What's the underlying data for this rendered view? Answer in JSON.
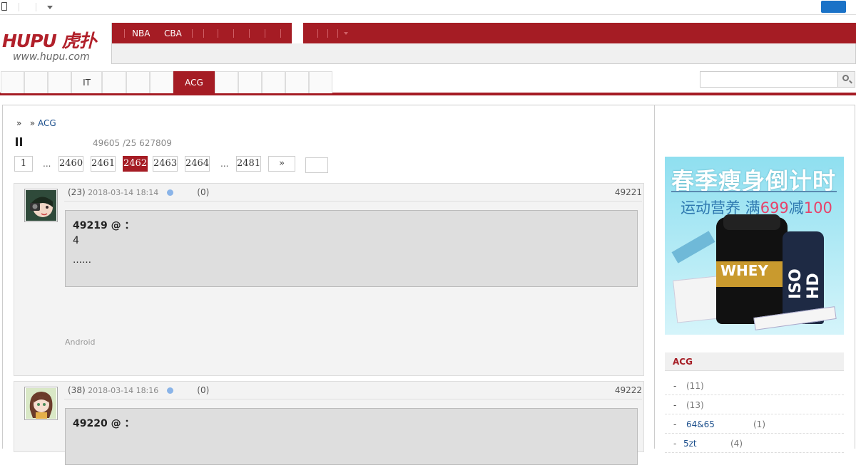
{
  "header": {
    "logo_text": "HUPU 虎扑",
    "logo_url": "www.hupu.com",
    "nav": [
      "NBA",
      "CBA"
    ]
  },
  "subnav": {
    "tabs": [
      {
        "label": ""
      },
      {
        "label": ""
      },
      {
        "label": ""
      },
      {
        "label": "IT"
      },
      {
        "label": ""
      },
      {
        "label": ""
      },
      {
        "label": ""
      },
      {
        "label": "ACG",
        "active": true
      },
      {
        "label": ""
      },
      {
        "label": ""
      },
      {
        "label": ""
      },
      {
        "label": ""
      },
      {
        "label": ""
      },
      {
        "label": ""
      }
    ],
    "search_placeholder": ""
  },
  "breadcrumb": {
    "sep1": "»",
    "sep2": "»",
    "forum": "ACG"
  },
  "thread": {
    "stats": "49605 /25  627809"
  },
  "pagination": {
    "first": "1",
    "ellipsis": "...",
    "pages": [
      "2460",
      "2461",
      "2462",
      "2463",
      "2464"
    ],
    "current": "2462",
    "last": "2481",
    "next": "»"
  },
  "posts": [
    {
      "level": "(23)",
      "time": "2018-03-14 18:14",
      "likes": "(0)",
      "floor": "49221",
      "quote_title": "49219 @  ：",
      "quote_body": "4",
      "quote_more": "……",
      "source": "Android"
    },
    {
      "level": "(38)",
      "time": "2018-03-14 18:16",
      "likes": "(0)",
      "floor": "49222",
      "quote_title": "49220 @  ："
    }
  ],
  "ad": {
    "line1": "春季瘦身倒计时",
    "line2_prefix": "运动营养 满",
    "line2_a": "699",
    "line2_mid": "减",
    "line2_b": "100",
    "product1": "WHEY",
    "product2": "ISO HD"
  },
  "sidebar": {
    "title": "ACG",
    "rows": [
      {
        "name": "",
        "count": "(11)"
      },
      {
        "name": "",
        "count": "(13)"
      },
      {
        "name": "64&65",
        "count": "(1)"
      },
      {
        "name": "5zt",
        "count": "(4)"
      }
    ]
  },
  "colors": {
    "brand_red": "#a51c24",
    "link_blue": "#1c4f8c"
  }
}
